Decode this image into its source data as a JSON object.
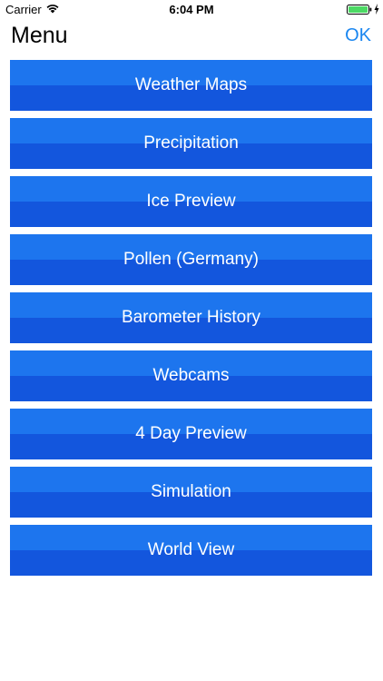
{
  "status_bar": {
    "carrier": "Carrier",
    "time": "6:04 PM",
    "battery_color": "#4cd964"
  },
  "nav": {
    "title": "Menu",
    "ok_label": "OK",
    "ok_color": "#1a86f0"
  },
  "menu": {
    "button_colors": {
      "top": "#1d75ee",
      "bottom": "#1356dd"
    },
    "items": [
      {
        "label": "Weather Maps"
      },
      {
        "label": "Precipitation"
      },
      {
        "label": "Ice Preview"
      },
      {
        "label": "Pollen (Germany)"
      },
      {
        "label": "Barometer History"
      },
      {
        "label": "Webcams"
      },
      {
        "label": "4 Day Preview"
      },
      {
        "label": "Simulation"
      },
      {
        "label": "World View"
      }
    ]
  }
}
